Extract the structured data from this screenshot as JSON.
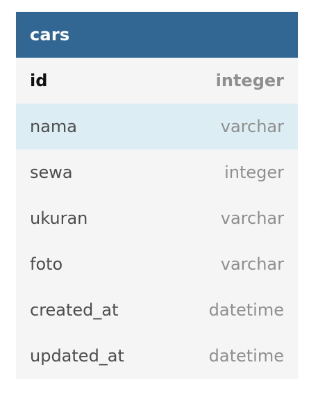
{
  "table": {
    "name": "cars",
    "colors": {
      "header_bg": "#316792",
      "body_bg": "#f5f5f5",
      "highlight_bg": "#ddedf4"
    },
    "columns": [
      {
        "name": "id",
        "type": "integer",
        "primary_key": true,
        "highlighted": false
      },
      {
        "name": "nama",
        "type": "varchar",
        "primary_key": false,
        "highlighted": true
      },
      {
        "name": "sewa",
        "type": "integer",
        "primary_key": false,
        "highlighted": false
      },
      {
        "name": "ukuran",
        "type": "varchar",
        "primary_key": false,
        "highlighted": false
      },
      {
        "name": "foto",
        "type": "varchar",
        "primary_key": false,
        "highlighted": false
      },
      {
        "name": "created_at",
        "type": "datetime",
        "primary_key": false,
        "highlighted": false
      },
      {
        "name": "updated_at",
        "type": "datetime",
        "primary_key": false,
        "highlighted": false
      }
    ]
  }
}
